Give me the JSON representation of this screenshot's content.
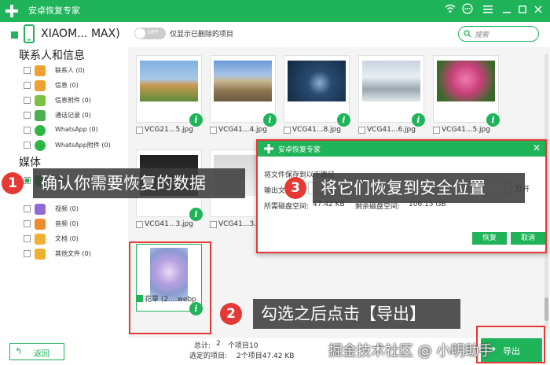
{
  "app": {
    "title": "安卓恢复专家"
  },
  "device": {
    "name": "XIAOM... MAX)",
    "toggle_state": "OFF",
    "toggle_label": "仅显示已删除的项目",
    "search_placeholder": "搜索"
  },
  "sidebar": {
    "group1": "联系人和信息",
    "group2": "媒体",
    "items1": [
      {
        "label": "联系人 (0)",
        "color": "#f0a030"
      },
      {
        "label": "信息 (0)",
        "color": "#f0a030"
      },
      {
        "label": "信息附件 (0)",
        "color": "#7cc242"
      },
      {
        "label": "通话记录 (0)",
        "color": "#4caf50"
      },
      {
        "label": "WhatsApp (0)",
        "color": "#2db742"
      },
      {
        "label": "WhatsApp附件 (0)",
        "color": "#2db742"
      }
    ],
    "items2": [
      {
        "label": "照片",
        "color": "#2db742"
      },
      {
        "label": "视频 (0)",
        "color": "#8e6ad8"
      },
      {
        "label": "音频 (0)",
        "color": "#f08a30"
      },
      {
        "label": "文档 (0)",
        "color": "#f0b030"
      },
      {
        "label": "其他文件 (0)",
        "color": "#f0b030"
      }
    ]
  },
  "files": [
    {
      "name": "VCG21...5.jpg"
    },
    {
      "name": "VCG41...4.jpg"
    },
    {
      "name": "VCG41...8.jpg"
    },
    {
      "name": "VCG41...6.jpg"
    },
    {
      "name": "VCG41...5.jpg"
    },
    {
      "name": "VCG41...3.jpg"
    },
    {
      "name": "VCG41...3.jpg"
    },
    {
      "name": "花草 (2....webp"
    }
  ],
  "dialog": {
    "title": "安卓恢复专家",
    "line1": "将文件保存到以下路径",
    "output_label": "输出文",
    "open_label": "打开",
    "disk_label": "所需磁盘空间:",
    "disk_value": "47.42 KB",
    "free_label": "剩余磁盘空间:",
    "free_value": "106.15 GB",
    "ok": "恢复",
    "cancel": "取消"
  },
  "callouts": [
    {
      "num": "1",
      "text": "确认你需要恢复的数据"
    },
    {
      "num": "2",
      "text": "勾选之后点击【导出】"
    },
    {
      "num": "3",
      "text": "将它们恢复到安全位置"
    }
  ],
  "bottom": {
    "back": "返回",
    "total_label": "总计:",
    "total_value": "2",
    "total_rest": "个项目10",
    "selected_label": "选定的项目:",
    "selected_value": "2个项目47.42 KB",
    "export": "导出"
  },
  "watermark": "掘金技术社区 @ 小明助手"
}
